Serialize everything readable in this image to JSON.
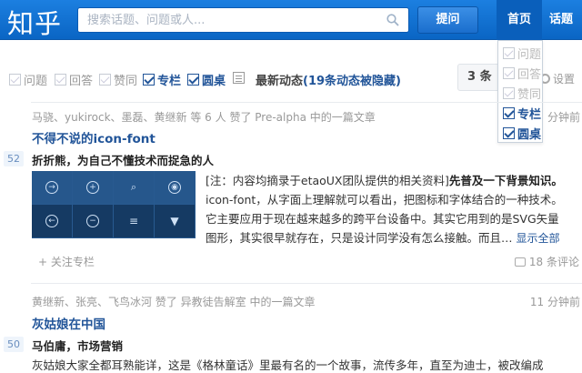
{
  "header": {
    "logo": "知乎",
    "search_placeholder": "搜索话题、问题或人...",
    "ask_button": "提问",
    "nav": [
      "首页",
      "话题"
    ]
  },
  "filters": {
    "items": [
      {
        "label": "问题",
        "checked": false
      },
      {
        "label": "回答",
        "checked": false
      },
      {
        "label": "赞同",
        "checked": false
      },
      {
        "label": "专栏",
        "checked": true
      },
      {
        "label": "圆桌",
        "checked": true
      }
    ],
    "latest_label": "最新动态",
    "hidden_note": "(19条动态被隐藏)",
    "count_box": "3 条",
    "settings": "设置"
  },
  "dropdown": {
    "items": [
      {
        "label": "问题",
        "checked": false
      },
      {
        "label": "回答",
        "checked": false
      },
      {
        "label": "赞同",
        "checked": false
      },
      {
        "label": "专栏",
        "checked": true
      },
      {
        "label": "圆桌",
        "checked": true
      }
    ]
  },
  "feed": [
    {
      "meta": "马骁、yukirock、墨磊、黄继新 等 6 人 赞了 Pre-alpha 中的一篇文章",
      "time": "分钟前",
      "title": "不得不说的icon-font",
      "votes": "52",
      "author": "折折熊，为自己不懂技术而捉急的人",
      "excerpt_lines": [
        "[注：内容均摘录于etaoUX团队提供的相关资料]",
        "先普及一下背景知识。",
        "icon-font，从字面上理解就可以看出，把图标和字体结合的一种技术。",
        "它主要应用于现在越来越多的跨平台设备中。其实它用到的是SVG矢量",
        "图形，其实很早就存在，只是设计同学没有怎么接触。而且…"
      ],
      "show_all": "显示全部",
      "follow": "+ 关注专栏",
      "comments": "18 条评论"
    },
    {
      "meta": "黄继新、张亮、飞鸟冰河 赞了 异教徒告解室 中的一篇文章",
      "time": "11 分钟前",
      "title": "灰姑娘在中国",
      "votes": "50",
      "author": "马伯庸，市场营销",
      "excerpt": "灰姑娘大家全都耳熟能详，这是《格林童话》里最有名的一个故事，流传多年，直至为迪士，被改编成"
    }
  ]
}
